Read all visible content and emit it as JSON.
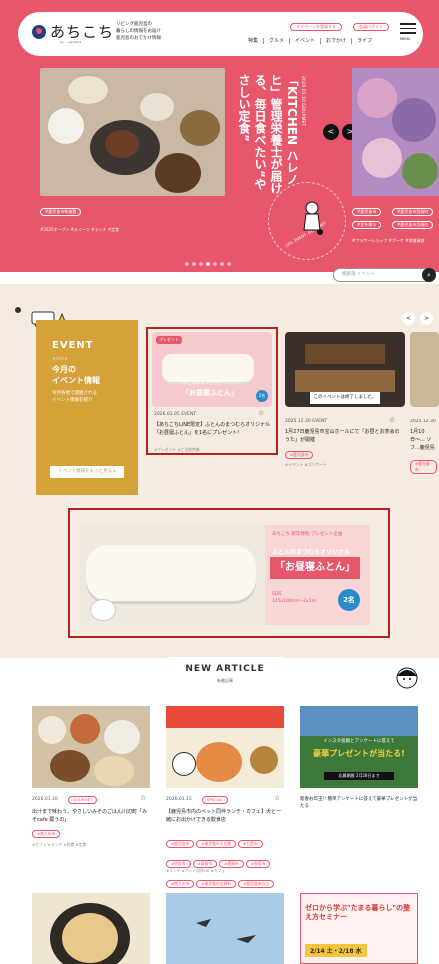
{
  "header": {
    "logo": "あちこち",
    "logo_sub": "by ... Aerobics",
    "tagline": "リビング鹿児島の\n暮らしの情報をお届け\n鹿児島のおでかけ情報",
    "btn1": "マイページを登録する",
    "btn2": "会員ログイン",
    "nav": [
      "特集",
      "グルメ",
      "イベント",
      "おでかけ",
      "ライフ"
    ],
    "menu": "MENU"
  },
  "hero": {
    "vertical_text": "「KITCHEN ハレノヒ」管理栄養士が届ける、毎日食べたい“やさしい定食”",
    "date": "2026.01.10 GOURMET",
    "tag": "#鹿児島市新屋敷",
    "small_tags": "#2025オープン  #スイーツ  #ランチ  #定食",
    "right_tags": [
      "#鹿児島市",
      "#鹿児島市呉服町"
    ],
    "right_tags2": [
      "#花を贈る",
      "#鹿児島市呉服町"
    ],
    "right_small": "#フラワーショップ  #ブーケ  #地域貢献",
    "curve_text": "LIFE, EVENT, GOURMET",
    "prev": "<",
    "next": ">"
  },
  "search": {
    "placeholder": "検索語 イベント",
    "icon": "search-icon"
  },
  "event": {
    "title": "EVENT",
    "small": "イベント",
    "big": "今月の\nイベント情報",
    "desc": "今月各地で開催される\nイベント情報を紹介",
    "btn": "イベント情報をもっと見る ▸",
    "nav_prev": "<",
    "nav_next": ">",
    "cards": [
      {
        "date": "2026.01.05 EVENT",
        "title": "【あちこちLINE限定】ふとんのまつむらオリジナル「お昼寝ふとん」を1名にプレゼント!",
        "tags": "#プレゼント  #ご当地特典",
        "badge": "プレゼント",
        "overlay1": "ふとんのまつむらオリジナル",
        "overlay2": "「お昼寝ふとん」",
        "count": "2名"
      },
      {
        "date": "2025.12.30 EVENT",
        "title": "1月27日鹿児島市宝山ホールにて「お昼とお茶会のうた」が開催",
        "tags": "#イベント  #コンサート",
        "pill": "#鹿児島市",
        "overlay": "このイベントは終了しました。"
      },
      {
        "date": "2025.12.30",
        "title": "1月10日〜... ソフ...鹿児島 「ラ...",
        "tags": "",
        "pill": "#鹿児島市"
      }
    ]
  },
  "banner": {
    "badge": "あちこち 新年特別 プレゼント企画",
    "line1": "ふとんのまつむらオリジナル",
    "line2": "「お昼寝ふとん」",
    "size": "SIZE\n145x100cm〜2x1m",
    "count": "2名"
  },
  "new_article": {
    "title": "NEW ARTICLE",
    "sub": "新着記事",
    "items": [
      {
        "date": "2026.01.10",
        "cat": "GOURMET",
        "title": "出汁まで味わう、やさしいみそのごはん川辺町「みそcafe 蔵うの」",
        "pills": [
          "#南九州市"
        ],
        "tags": "#カフェ  #ランチ  #和食  #定食"
      },
      {
        "date": "2026.01.15",
        "cat": "SPECIAL",
        "title": "【鹿児島市内のペット同伴ランチ・カフェ】犬と一緒にお出かけできる飲食店",
        "pills": [
          "#鹿児島市",
          "#鹿児島市天文館",
          "#日置市",
          "#姶良市",
          "#霧島市",
          "#鹿屋市",
          "#指宿市",
          "#南九州市",
          "#鹿児島市吉野町",
          "#鹿児島市谷山"
        ],
        "tags": "#ランチ  #ペット同伴OK  #カフェ"
      },
      {
        "date": "",
        "cat": "",
        "title": "新春お年玉!! 簡単アンケートに答えて豪華プレゼントが当たる",
        "pills": [],
        "tags": "",
        "img_text1": "インスタ投稿とアンケートに答えて",
        "img_text2": "豪華プレゼントが当たる!",
        "img_text3": "応募期間 2月28日まで"
      }
    ],
    "bottom": [
      {
        "img": "ramen"
      },
      {
        "img": "sky"
      },
      {
        "text1": "ゼロから学ぶ\"たまる暮らし\"の整え方セミナー",
        "text2": "2/14 土・2/18 水"
      }
    ]
  }
}
